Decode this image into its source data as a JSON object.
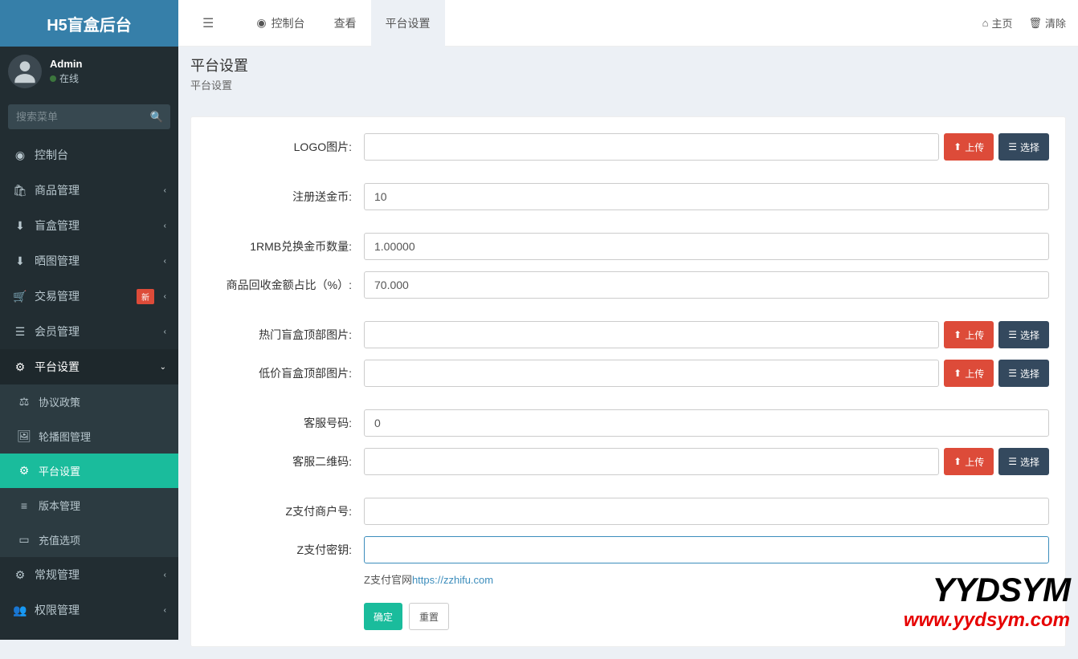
{
  "app": {
    "title": "H5盲盒后台"
  },
  "user": {
    "name": "Admin",
    "status": "在线"
  },
  "sidebar": {
    "search_placeholder": "搜索菜单",
    "items": [
      {
        "label": "控制台",
        "icon": "dashboard"
      },
      {
        "label": "商品管理",
        "icon": "bag",
        "expandable": true
      },
      {
        "label": "盲盒管理",
        "icon": "box",
        "expandable": true
      },
      {
        "label": "晒图管理",
        "icon": "gallery",
        "expandable": true
      },
      {
        "label": "交易管理",
        "icon": "cart",
        "expandable": true,
        "badge": "新"
      },
      {
        "label": "会员管理",
        "icon": "list",
        "expandable": true
      },
      {
        "label": "平台设置",
        "icon": "cogs",
        "expandable": true,
        "expanded": true
      }
    ],
    "sub": [
      {
        "label": "协议政策",
        "icon": "scale"
      },
      {
        "label": "轮播图管理",
        "icon": "image"
      },
      {
        "label": "平台设置",
        "icon": "cog",
        "active": true
      },
      {
        "label": "版本管理",
        "icon": "list2"
      },
      {
        "label": "充值选项",
        "icon": "wallet"
      }
    ],
    "items2": [
      {
        "label": "常规管理",
        "icon": "cogs",
        "expandable": true
      },
      {
        "label": "权限管理",
        "icon": "users",
        "expandable": true
      }
    ]
  },
  "topbar": {
    "tabs": [
      {
        "label": "控制台",
        "icon": "dashboard"
      },
      {
        "label": "查看"
      },
      {
        "label": "平台设置",
        "active": true
      }
    ],
    "home": "主页",
    "clear": "清除"
  },
  "page": {
    "title": "平台设置",
    "subtitle": "平台设置"
  },
  "form": {
    "labels": {
      "logo": "LOGO图片:",
      "register_coin": "注册送金币:",
      "rmb_rate": "1RMB兑换金币数量:",
      "recycle_ratio": "商品回收金额占比（%）:",
      "hot_banner": "热门盲盒顶部图片:",
      "low_banner": "低价盲盒顶部图片:",
      "service_no": "客服号码:",
      "service_qr": "客服二维码:",
      "zpay_merchant": "Z支付商户号:",
      "zpay_secret": "Z支付密钥:"
    },
    "values": {
      "logo": "",
      "register_coin": "10",
      "rmb_rate": "1.00000",
      "recycle_ratio": "70.000",
      "hot_banner": "",
      "low_banner": "",
      "service_no": "0",
      "service_qr": "",
      "zpay_merchant": "",
      "zpay_secret": ""
    },
    "help": {
      "zpay_prefix": "Z支付官网",
      "zpay_link": "https://zzhifu.com"
    },
    "buttons": {
      "upload": "上传",
      "choose": "选择",
      "submit": "确定",
      "reset": "重置"
    }
  },
  "watermark": {
    "line1": "YYDSYM",
    "line2": "www.yydsym.com"
  }
}
